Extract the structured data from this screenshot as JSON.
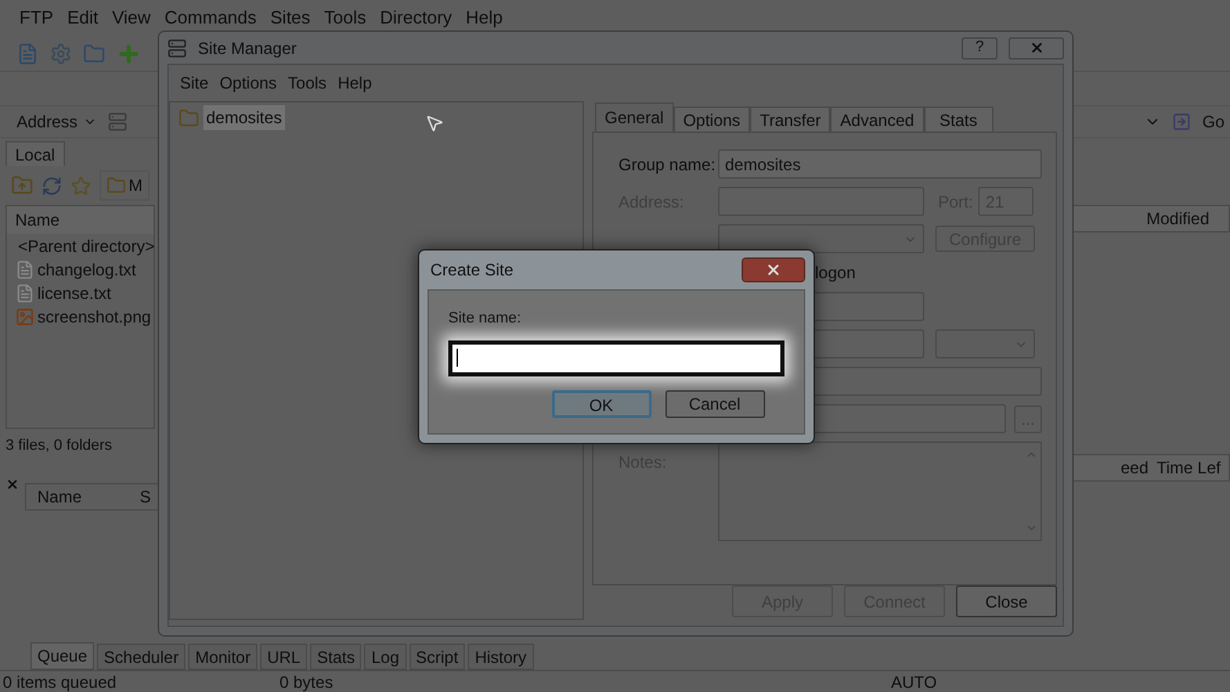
{
  "menu": [
    "FTP",
    "Edit",
    "View",
    "Commands",
    "Sites",
    "Tools",
    "Directory",
    "Help"
  ],
  "address": {
    "label": "Address",
    "go": "Go"
  },
  "local_panel": {
    "tab": "Local",
    "folder": "M",
    "column": "Name",
    "files": [
      {
        "name": "<Parent directory>",
        "kind": "parent"
      },
      {
        "name": "changelog.txt",
        "kind": "text"
      },
      {
        "name": "license.txt",
        "kind": "text"
      },
      {
        "name": "screenshot.png",
        "kind": "image"
      }
    ],
    "status": "3 files, 0 folders"
  },
  "remote_panel": {
    "column": "Modified"
  },
  "queue": {
    "columns": [
      "Name",
      "S"
    ],
    "right_columns": [
      "eed",
      "Time Lef"
    ],
    "tabs": [
      {
        "label": "Queue",
        "selected": true
      },
      {
        "label": "Scheduler",
        "selected": false
      },
      {
        "label": "Monitor",
        "selected": false
      },
      {
        "label": "URL",
        "selected": false
      },
      {
        "label": "Stats",
        "selected": false
      },
      {
        "label": "Log",
        "selected": false
      },
      {
        "label": "Script",
        "selected": false
      },
      {
        "label": "History",
        "selected": false
      }
    ]
  },
  "status_bar": [
    "0 items queued",
    "0 bytes",
    "AUTO"
  ],
  "site_manager": {
    "title": "Site Manager",
    "help": "?",
    "menu": [
      "Site",
      "Options",
      "Tools",
      "Help"
    ],
    "tree": [
      {
        "label": "demosites",
        "selected": true
      }
    ],
    "tabs": [
      {
        "label": "General",
        "selected": true
      },
      {
        "label": "Options",
        "selected": false
      },
      {
        "label": "Transfer",
        "selected": false
      },
      {
        "label": "Advanced",
        "selected": false
      },
      {
        "label": "Stats",
        "selected": false
      }
    ],
    "group_name": {
      "label": "Group name:",
      "value": "demosites"
    },
    "address": {
      "label": "Address:",
      "disabled": true
    },
    "port": {
      "label": "Port:",
      "value": "21",
      "disabled": true
    },
    "configure": "Configure",
    "logon": "logon",
    "browse": "...",
    "notes": {
      "label": "Notes:",
      "disabled": true
    },
    "buttons": [
      {
        "label": "Apply",
        "disabled": true
      },
      {
        "label": "Connect",
        "disabled": true
      },
      {
        "label": "Close",
        "disabled": false
      }
    ]
  },
  "create_site": {
    "title": "Create Site",
    "label": "Site name:",
    "buttons": [
      "OK",
      "Cancel"
    ]
  }
}
